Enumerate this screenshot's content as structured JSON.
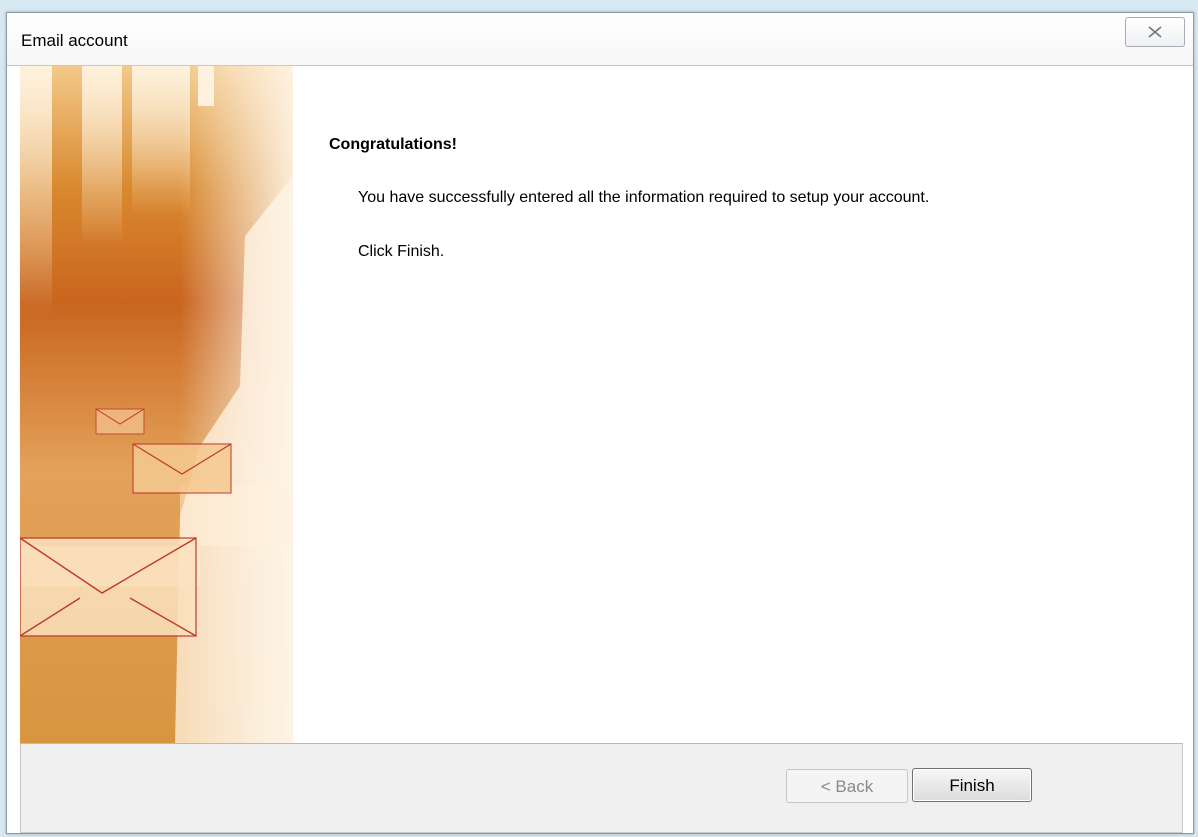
{
  "window": {
    "title": "Email account"
  },
  "content": {
    "heading": "Congratulations!",
    "message_line1": "You have successfully entered all the information required to setup your account.",
    "message_line2": "Click Finish."
  },
  "buttons": {
    "back_label": "< Back",
    "back_enabled": false,
    "finish_label": "Finish"
  },
  "icons": {
    "close": "close-icon",
    "banner": "envelope-banner-illustration"
  },
  "colors": {
    "banner_orange": "#d9872e",
    "banner_light": "#f6dcb8",
    "envelope_stroke": "#c0392b"
  }
}
